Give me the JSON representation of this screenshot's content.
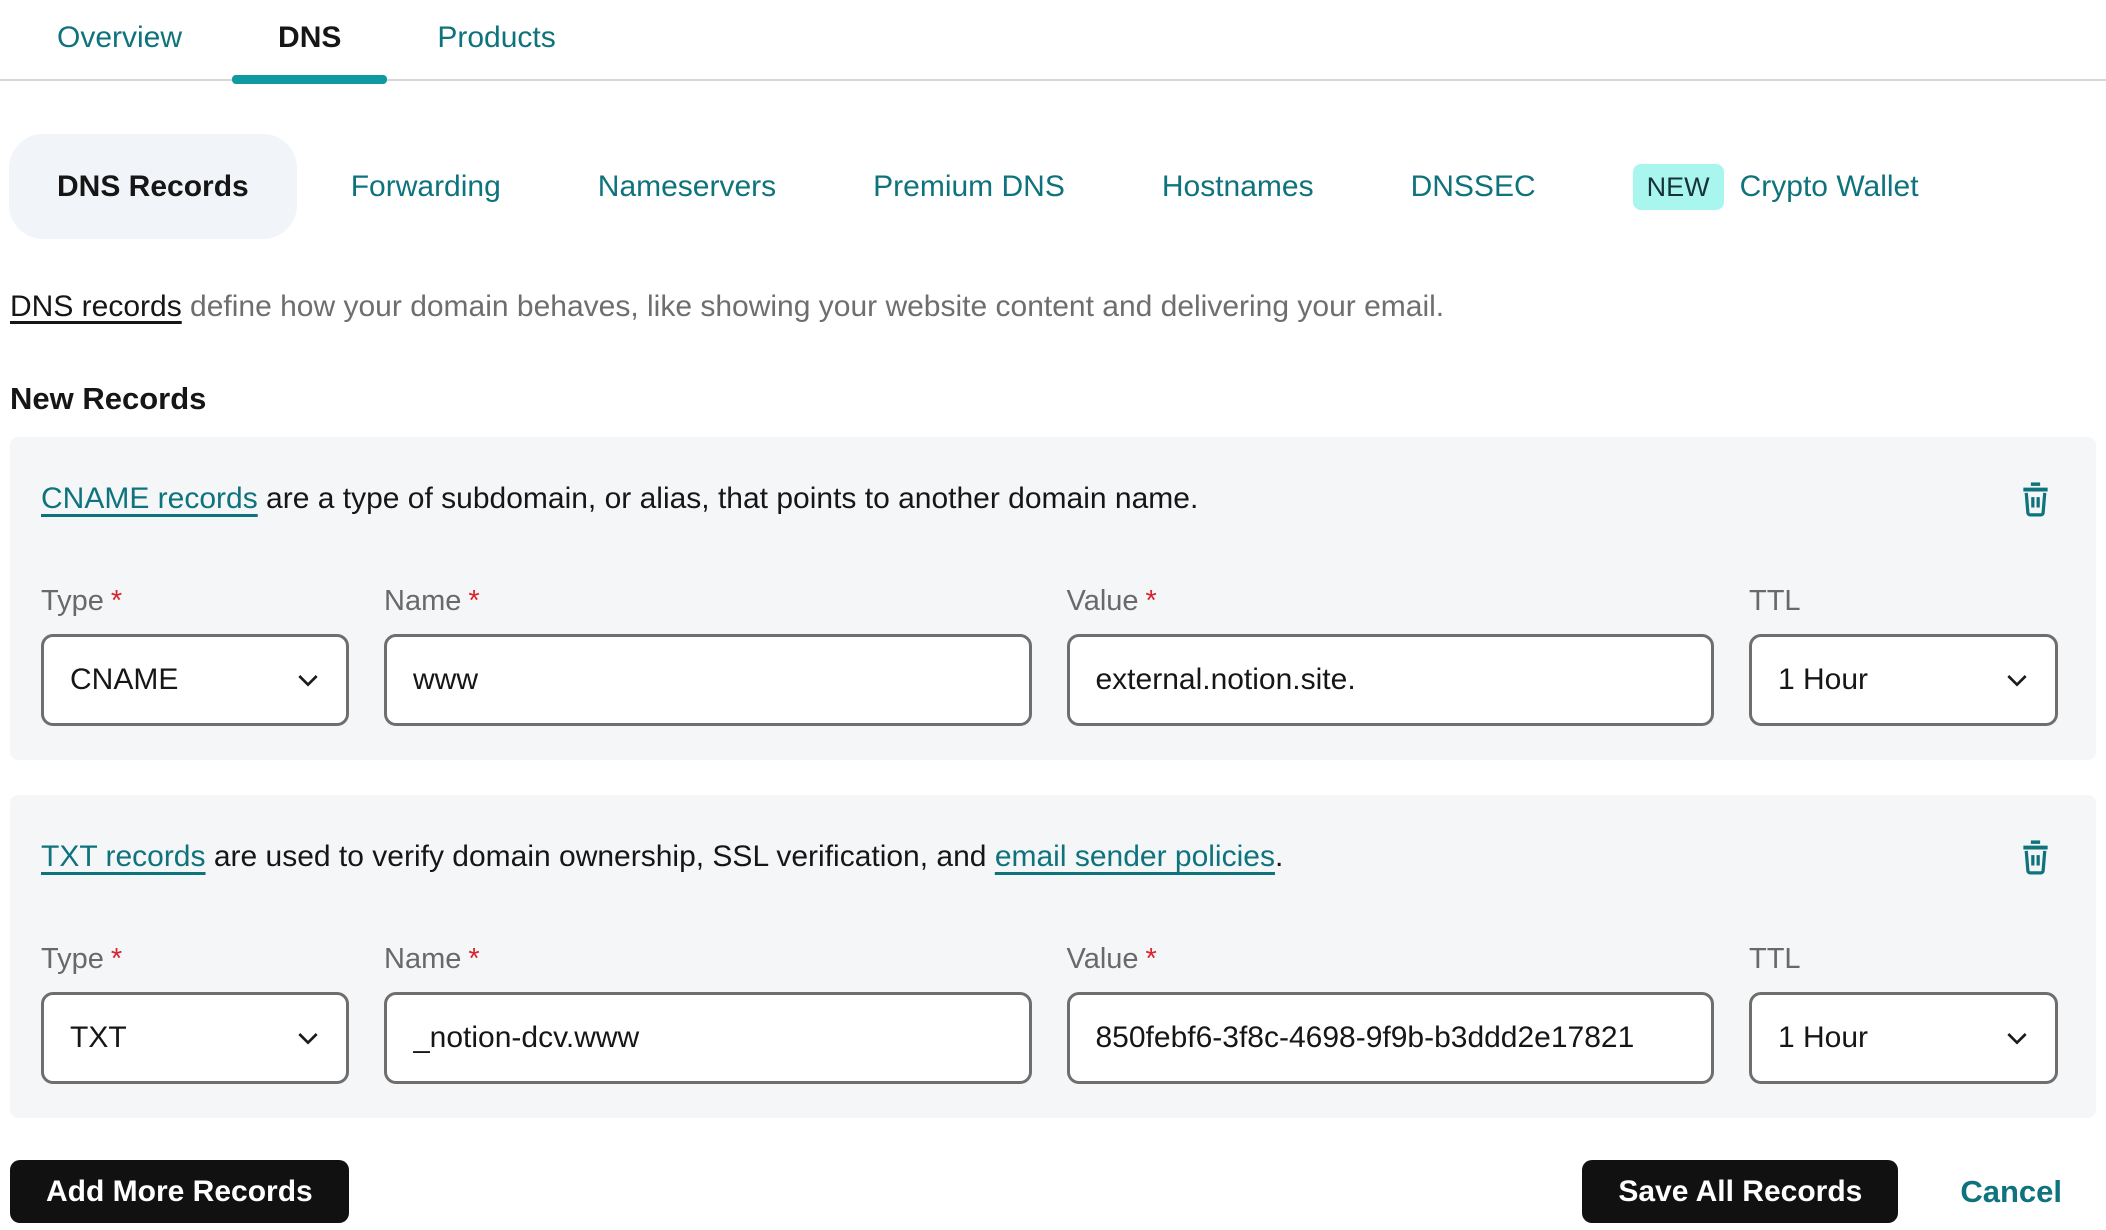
{
  "tabs": [
    {
      "label": "Overview",
      "active": false
    },
    {
      "label": "DNS",
      "active": true
    },
    {
      "label": "Products",
      "active": false
    }
  ],
  "subtabs": [
    {
      "label": "DNS Records",
      "active": true
    },
    {
      "label": "Forwarding",
      "active": false
    },
    {
      "label": "Nameservers",
      "active": false
    },
    {
      "label": "Premium DNS",
      "active": false
    },
    {
      "label": "Hostnames",
      "active": false
    },
    {
      "label": "DNSSEC",
      "active": false
    },
    {
      "label": "Crypto Wallet",
      "active": false,
      "badge": "NEW"
    }
  ],
  "description": {
    "link_text": "DNS records",
    "text": " define how your domain behaves, like showing your website content and delivering your email."
  },
  "section_title": "New Records",
  "form_labels": {
    "type": "Type",
    "name": "Name",
    "value": "Value",
    "ttl": "TTL",
    "required_mark": "*"
  },
  "records": [
    {
      "intro_link": "CNAME records",
      "intro_text": " are a type of subdomain, or alias, that points to another domain name.",
      "intro_link2": "",
      "intro_text2": "",
      "type_value": "CNAME",
      "name_value": "www",
      "value_value": "external.notion.site.",
      "ttl_value": "1 Hour"
    },
    {
      "intro_link": "TXT records",
      "intro_text": " are used to verify domain ownership, SSL verification, and ",
      "intro_link2": "email sender policies",
      "intro_text2": ".",
      "type_value": "TXT",
      "name_value": "_notion-dcv.www",
      "value_value": "850febf6-3f8c-4698-9f9b-b3ddd2e17821",
      "ttl_value": "1 Hour"
    }
  ],
  "footer": {
    "add_more_label": "Add More Records",
    "save_all_label": "Save All Records",
    "cancel_label": "Cancel"
  },
  "icons": {
    "delete": "trash-icon",
    "select": "chevron-down-icon"
  },
  "colors": {
    "accent_teal": "#0e737c",
    "active_tab_underline": "#0f9aa1",
    "new_badge_bg": "#a9f6ef",
    "card_bg": "#f4f6f8",
    "active_pill_bg": "#f1f4f8",
    "input_border": "#6e6e6e",
    "label_gray": "#696969",
    "description_gray": "#6e6e6e",
    "required_red": "#d9232e",
    "button_bg": "#111111"
  }
}
